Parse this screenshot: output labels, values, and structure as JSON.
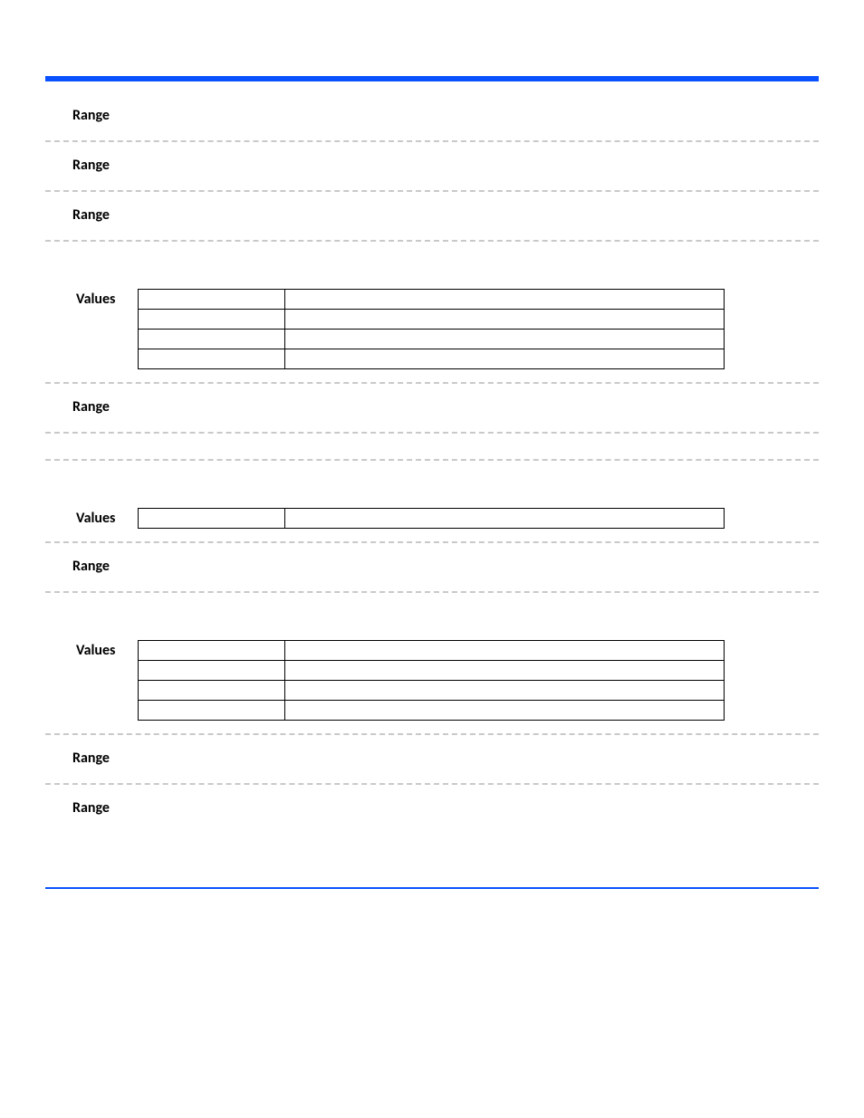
{
  "labels": {
    "range": "Range",
    "values": "Values"
  },
  "sections": [
    {
      "type": "range"
    },
    {
      "type": "range"
    },
    {
      "type": "range"
    },
    {
      "type": "values",
      "rows": [
        {
          "k": "",
          "v": ""
        },
        {
          "k": "",
          "v": ""
        },
        {
          "k": "",
          "v": ""
        },
        {
          "k": "",
          "v": ""
        }
      ]
    },
    {
      "type": "range"
    },
    {
      "type": "divider"
    },
    {
      "type": "values",
      "rows": [
        {
          "k": "",
          "v": ""
        }
      ]
    },
    {
      "type": "range"
    },
    {
      "type": "values",
      "rows": [
        {
          "k": "",
          "v": ""
        },
        {
          "k": "",
          "v": ""
        },
        {
          "k": "",
          "v": ""
        },
        {
          "k": "",
          "v": ""
        }
      ]
    },
    {
      "type": "range"
    },
    {
      "type": "range"
    }
  ]
}
